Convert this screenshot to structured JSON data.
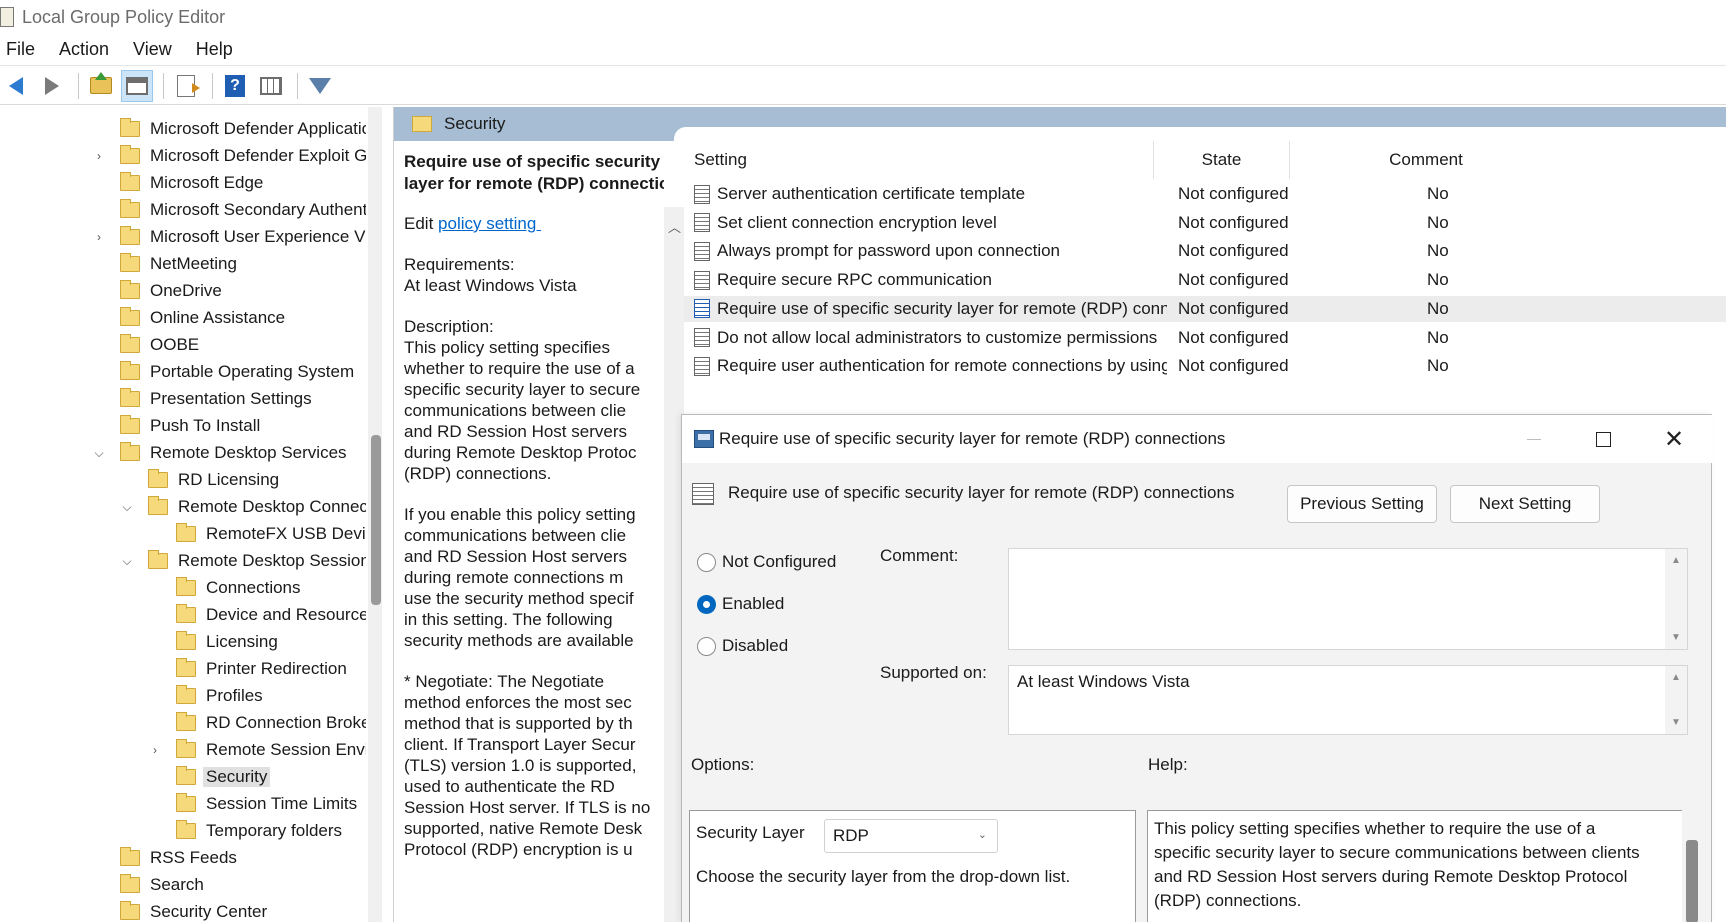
{
  "window": {
    "title": "Local Group Policy Editor"
  },
  "menu": [
    "File",
    "Action",
    "View",
    "Help"
  ],
  "toolbar": {
    "icons": [
      "back-arrow-icon",
      "forward-arrow-icon",
      "up-folder-icon",
      "show-hide-tree-icon",
      "export-list-icon",
      "help-icon",
      "extended-view-icon",
      "filter-icon"
    ]
  },
  "tree": {
    "items": [
      {
        "label": "Microsoft Defender Application G",
        "indent": 0,
        "twisty": ""
      },
      {
        "label": "Microsoft Defender Exploit Guar",
        "indent": 0,
        "twisty": ">"
      },
      {
        "label": "Microsoft Edge",
        "indent": 0,
        "twisty": ""
      },
      {
        "label": "Microsoft Secondary Authenticat",
        "indent": 0,
        "twisty": ""
      },
      {
        "label": "Microsoft User Experience Virtua",
        "indent": 0,
        "twisty": ">"
      },
      {
        "label": "NetMeeting",
        "indent": 0,
        "twisty": ""
      },
      {
        "label": "OneDrive",
        "indent": 0,
        "twisty": ""
      },
      {
        "label": "Online Assistance",
        "indent": 0,
        "twisty": ""
      },
      {
        "label": "OOBE",
        "indent": 0,
        "twisty": ""
      },
      {
        "label": "Portable Operating System",
        "indent": 0,
        "twisty": ""
      },
      {
        "label": "Presentation Settings",
        "indent": 0,
        "twisty": ""
      },
      {
        "label": "Push To Install",
        "indent": 0,
        "twisty": ""
      },
      {
        "label": "Remote Desktop Services",
        "indent": 0,
        "twisty": "v"
      },
      {
        "label": "RD Licensing",
        "indent": 1,
        "twisty": ""
      },
      {
        "label": "Remote Desktop Connection",
        "indent": 1,
        "twisty": "v"
      },
      {
        "label": "RemoteFX USB Device Re",
        "indent": 2,
        "twisty": ""
      },
      {
        "label": "Remote Desktop Session Hos",
        "indent": 1,
        "twisty": "v"
      },
      {
        "label": "Connections",
        "indent": 2,
        "twisty": ""
      },
      {
        "label": "Device and Resource Red",
        "indent": 2,
        "twisty": ""
      },
      {
        "label": "Licensing",
        "indent": 2,
        "twisty": ""
      },
      {
        "label": "Printer Redirection",
        "indent": 2,
        "twisty": ""
      },
      {
        "label": "Profiles",
        "indent": 2,
        "twisty": ""
      },
      {
        "label": "RD Connection Broker",
        "indent": 2,
        "twisty": ""
      },
      {
        "label": "Remote Session Environn",
        "indent": 2,
        "twisty": ">"
      },
      {
        "label": "Security",
        "indent": 2,
        "twisty": "",
        "selected": true
      },
      {
        "label": "Session Time Limits",
        "indent": 2,
        "twisty": ""
      },
      {
        "label": "Temporary folders",
        "indent": 2,
        "twisty": ""
      },
      {
        "label": "RSS Feeds",
        "indent": 0,
        "twisty": ""
      },
      {
        "label": "Search",
        "indent": 0,
        "twisty": ""
      },
      {
        "label": "Security Center",
        "indent": 0,
        "twisty": ""
      }
    ]
  },
  "path_header": {
    "label": "Security"
  },
  "description": {
    "title": "Require use of specific security\nlayer for remote (RDP) connections",
    "edit_prefix": "Edit ",
    "edit_link": "policy setting ",
    "requirements": "Requirements:\nAt least Windows Vista",
    "description_text": "Description:\nThis policy setting specifies\nwhether to require the use of a\nspecific security layer to secure\ncommunications between clie\nand RD Session Host servers\nduring Remote Desktop Protoc\n(RDP) connections.",
    "para2": "If you enable this policy setting\ncommunications between clie\nand RD Session Host servers\nduring remote connections m\nuse the security method specif\nin this setting. The following\nsecurity methods are available",
    "para3": "* Negotiate: The Negotiate\nmethod enforces the most sec\nmethod that is supported by th\nclient. If Transport Layer Secur\n(TLS) version 1.0 is supported,\nused to authenticate the RD\nSession Host server. If TLS is no\nsupported, native Remote Desk\nProtocol (RDP) encryption is u"
  },
  "list": {
    "headers": {
      "setting": "Setting",
      "state": "State",
      "comment": "Comment"
    },
    "rows": [
      {
        "name": "Server authentication certificate template",
        "state": "Not configured",
        "comment": "No"
      },
      {
        "name": "Set client connection encryption level",
        "state": "Not configured",
        "comment": "No"
      },
      {
        "name": "Always prompt for password upon connection",
        "state": "Not configured",
        "comment": "No"
      },
      {
        "name": "Require secure RPC communication",
        "state": "Not configured",
        "comment": "No"
      },
      {
        "name": "Require use of specific security layer for remote (RDP) connec...",
        "state": "Not configured",
        "comment": "No",
        "selected": true
      },
      {
        "name": "Do not allow local administrators to customize permissions",
        "state": "Not configured",
        "comment": "No"
      },
      {
        "name": "Require user authentication for remote connections by using...",
        "state": "Not configured",
        "comment": "No"
      }
    ]
  },
  "dialog": {
    "title": "Require use of specific security layer for remote (RDP) connections",
    "policy_name": "Require use of specific security layer for remote (RDP) connections",
    "prev_button": "Previous Setting",
    "next_button": "Next Setting",
    "radios": {
      "not_configured": "Not Configured",
      "enabled": "Enabled",
      "disabled": "Disabled",
      "selected": "enabled"
    },
    "comment_label": "Comment:",
    "comment_value": "",
    "supported_label": "Supported on:",
    "supported_value": "At least Windows Vista",
    "options_label": "Options:",
    "help_label": "Help:",
    "security_layer_label": "Security Layer",
    "security_layer_value": "RDP",
    "options_hint": "Choose the security layer from the drop-down list.",
    "help_text": "This policy setting specifies whether to require the use of a\nspecific security layer to secure communications between clients\nand RD Session Host servers during Remote Desktop Protocol\n(RDP) connections."
  },
  "colors": {
    "accent": "#0067c0",
    "header_band": "#a7bdd3",
    "link": "#0066cc",
    "selection": "#e0e0e0"
  }
}
